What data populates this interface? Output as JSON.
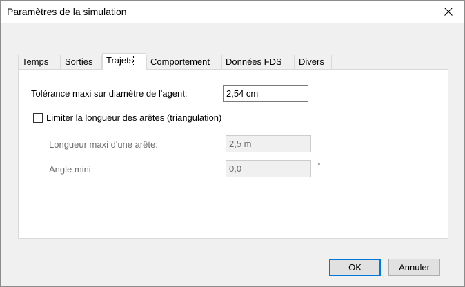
{
  "window": {
    "title": "Paramètres de la simulation",
    "close_icon": "close-icon"
  },
  "tabs": [
    {
      "label": "Temps",
      "active": false
    },
    {
      "label": "Sorties",
      "active": false
    },
    {
      "label": "Trajets",
      "active": true
    },
    {
      "label": "Comportement",
      "active": false
    },
    {
      "label": "Données FDS",
      "active": false
    },
    {
      "label": "Divers",
      "active": false
    }
  ],
  "trajets": {
    "tolerance_label": "Tolérance maxi sur diamètre de l'agent:",
    "tolerance_value": "2,54 cm",
    "limit_checkbox_label": "Limiter la longueur des arêtes (triangulation)",
    "limit_checked": false,
    "max_edge_label": "Longueur maxi d'une arête:",
    "max_edge_value": "2,5 m",
    "min_angle_label": "Angle mini:",
    "min_angle_value": "0,0",
    "min_angle_unit": "°"
  },
  "buttons": {
    "ok": "OK",
    "cancel": "Annuler"
  },
  "colors": {
    "accent": "#0078d7",
    "disabled_text": "#6d6d6d",
    "dialog_bg": "#f0f0f0"
  }
}
